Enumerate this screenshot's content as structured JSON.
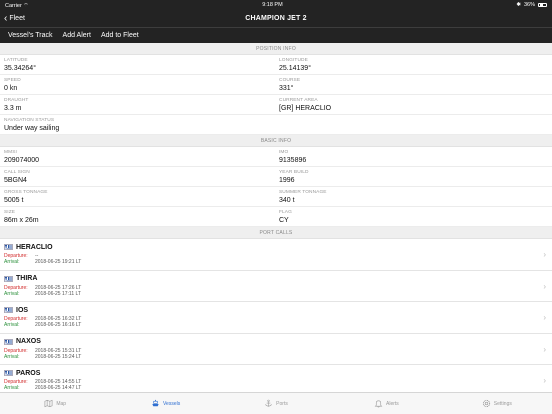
{
  "status": {
    "carrier": "Carrier",
    "time": "9:18 PM",
    "battery": "36%"
  },
  "nav": {
    "back_label": "Fleet",
    "title": "CHAMPION JET 2"
  },
  "actions": {
    "track": "Vessel's Track",
    "add_alert": "Add Alert",
    "add_fleet": "Add to Fleet"
  },
  "position": {
    "header": "POSITION INFO",
    "latitude_label": "LATITUDE",
    "latitude": "35.34264°",
    "longitude_label": "LONGITUDE",
    "longitude": "25.14139°",
    "speed_label": "SPEED",
    "speed": "0 kn",
    "course_label": "COURSE",
    "course": "331°",
    "draught_label": "DRAUGHT",
    "draught": "3.3 m",
    "area_label": "CURRENT AREA",
    "area": "[GR] HERACLIO",
    "nav_status_label": "NAVIGATION STATUS",
    "nav_status": "Under way sailing"
  },
  "basic": {
    "header": "BASIC INFO",
    "mmsi_label": "MMSI",
    "mmsi": "209074000",
    "imo_label": "IMO",
    "imo": "9135896",
    "callsign_label": "CALL SIGN",
    "callsign": "5BGN4",
    "year_label": "YEAR BUILD",
    "year": "1996",
    "gross_label": "GROSS TONNAGE",
    "gross": "5005 t",
    "summer_label": "SUMMER TONNAGE",
    "summer": "340 t",
    "size_label": "SIZE",
    "size": "86m x 26m",
    "flag_label": "FLAG",
    "flag": "CY"
  },
  "port_calls": {
    "header": "PORT CALLS",
    "departure_label": "Departure:",
    "arrival_label": "Arrival:",
    "items": [
      {
        "name": "HERACLIO",
        "departure": "--",
        "arrival": "2018-06-25 19:21 LT"
      },
      {
        "name": "THIRA",
        "departure": "2018-06-25 17:26 LT",
        "arrival": "2018-06-25 17:11 LT"
      },
      {
        "name": "IOS",
        "departure": "2018-06-25 16:32 LT",
        "arrival": "2018-06-25 16:16 LT"
      },
      {
        "name": "NAXOS",
        "departure": "2018-06-25 15:31 LT",
        "arrival": "2018-06-25 15:24 LT"
      },
      {
        "name": "PAROS",
        "departure": "2018-06-25 14:55 LT",
        "arrival": "2018-06-25 14:47 LT"
      }
    ]
  },
  "tabs": {
    "map": "Map",
    "vessels": "Vessels",
    "ports": "Ports",
    "alerts": "Alerts",
    "settings": "Settings"
  },
  "colors": {
    "accent": "#2f6fd1",
    "departure": "#d12a2a",
    "arrival": "#2a8f3a",
    "bar": "#232323"
  }
}
